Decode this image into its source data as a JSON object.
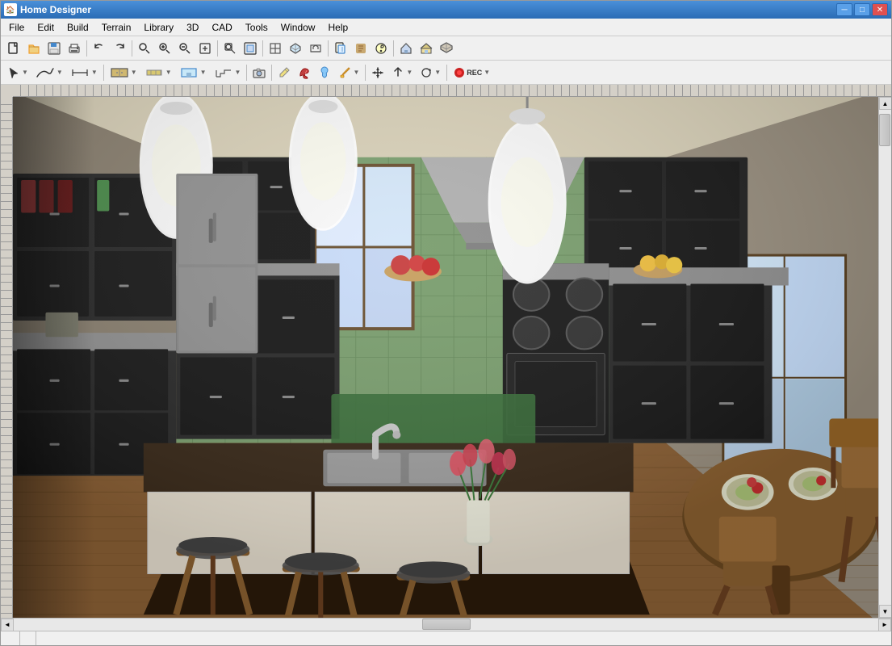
{
  "window": {
    "title": "Home Designer",
    "icon": "🏠"
  },
  "title_controls": {
    "minimize": "─",
    "maximize": "□",
    "close": "✕"
  },
  "menu": {
    "items": [
      {
        "label": "File",
        "id": "file"
      },
      {
        "label": "Edit",
        "id": "edit"
      },
      {
        "label": "Build",
        "id": "build"
      },
      {
        "label": "Terrain",
        "id": "terrain"
      },
      {
        "label": "Library",
        "id": "library"
      },
      {
        "label": "3D",
        "id": "3d"
      },
      {
        "label": "CAD",
        "id": "cad"
      },
      {
        "label": "Tools",
        "id": "tools"
      },
      {
        "label": "Window",
        "id": "window"
      },
      {
        "label": "Help",
        "id": "help"
      }
    ]
  },
  "toolbar1": {
    "buttons": [
      {
        "id": "new",
        "icon": "📄",
        "tooltip": "New"
      },
      {
        "id": "open",
        "icon": "📂",
        "tooltip": "Open"
      },
      {
        "id": "save",
        "icon": "💾",
        "tooltip": "Save"
      },
      {
        "id": "print",
        "icon": "🖨",
        "tooltip": "Print"
      },
      {
        "id": "undo",
        "icon": "↩",
        "tooltip": "Undo"
      },
      {
        "id": "redo",
        "icon": "↪",
        "tooltip": "Redo"
      },
      {
        "id": "zoom-in-out",
        "icon": "🔍",
        "tooltip": "Zoom"
      },
      {
        "id": "zoom-in",
        "icon": "+🔍",
        "tooltip": "Zoom In"
      },
      {
        "id": "zoom-out",
        "icon": "-🔍",
        "tooltip": "Zoom Out"
      },
      {
        "id": "fit-window",
        "icon": "⊡",
        "tooltip": "Fit in Window"
      },
      {
        "id": "select-all",
        "icon": "⊞",
        "tooltip": "Select All"
      },
      {
        "id": "zoom-preview",
        "icon": "🔎",
        "tooltip": "Zoom Preview"
      }
    ]
  },
  "toolbar2": {
    "buttons": [
      {
        "id": "select",
        "icon": "↖",
        "tooltip": "Select"
      },
      {
        "id": "polyline",
        "icon": "⌒",
        "tooltip": "Polyline"
      },
      {
        "id": "dimension",
        "icon": "↔",
        "tooltip": "Dimension"
      },
      {
        "id": "cabinet",
        "icon": "▦",
        "tooltip": "Cabinet"
      },
      {
        "id": "wall",
        "icon": "⬜",
        "tooltip": "Wall"
      },
      {
        "id": "room",
        "icon": "🏠",
        "tooltip": "Room"
      },
      {
        "id": "stairs",
        "icon": "≡",
        "tooltip": "Stairs"
      },
      {
        "id": "camera",
        "icon": "📷",
        "tooltip": "Camera"
      },
      {
        "id": "pencil",
        "icon": "✏",
        "tooltip": "Pencil"
      },
      {
        "id": "color",
        "icon": "🎨",
        "tooltip": "Color"
      },
      {
        "id": "material",
        "icon": "🎭",
        "tooltip": "Material"
      },
      {
        "id": "eyedropper",
        "icon": "💉",
        "tooltip": "Eyedropper"
      },
      {
        "id": "move",
        "icon": "✥",
        "tooltip": "Move"
      },
      {
        "id": "arrow-up",
        "icon": "⬆",
        "tooltip": "Move Up"
      },
      {
        "id": "transform",
        "icon": "⟲",
        "tooltip": "Transform"
      },
      {
        "id": "rec",
        "icon": "⏺",
        "tooltip": "Record",
        "label": "REC"
      }
    ]
  },
  "status_bar": {
    "panels": [
      "",
      "",
      ""
    ]
  },
  "scene": {
    "description": "3D Kitchen interior render with dark cabinets, green tile backsplash, wood floors, kitchen island with sink, pendant lights, and dining area"
  }
}
